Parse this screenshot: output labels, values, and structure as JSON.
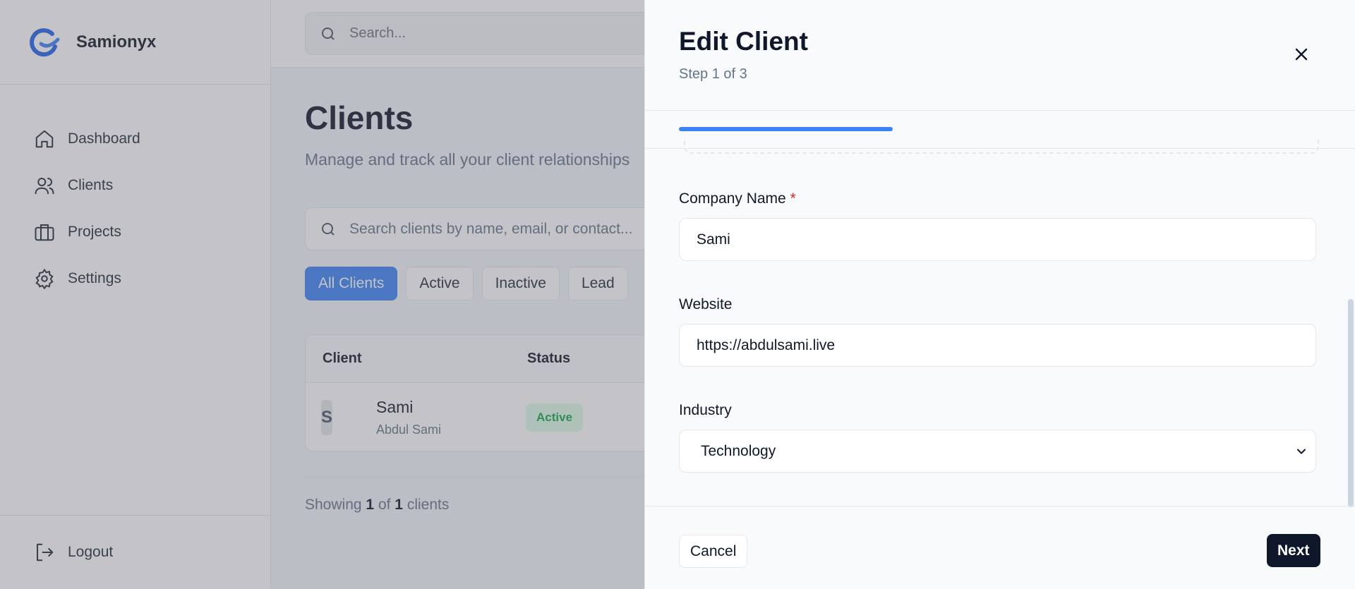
{
  "brand": {
    "name": "Samionyx",
    "logo_icon": "samionyx-logo-icon",
    "logo_color": "#2563eb"
  },
  "sidebar": {
    "items": [
      {
        "label": "Dashboard",
        "icon": "home-icon"
      },
      {
        "label": "Clients",
        "icon": "users-icon"
      },
      {
        "label": "Projects",
        "icon": "briefcase-icon"
      },
      {
        "label": "Settings",
        "icon": "gear-icon"
      }
    ],
    "logout": {
      "label": "Logout",
      "icon": "logout-icon"
    }
  },
  "topbar": {
    "search_placeholder": "Search..."
  },
  "main": {
    "title": "Clients",
    "subtitle": "Manage and track all your client relationships",
    "search_placeholder": "Search clients by name, email, or contact...",
    "filters": [
      "All Clients",
      "Active",
      "Inactive",
      "Lead"
    ],
    "active_filter": "All Clients",
    "table": {
      "headers": [
        "Client",
        "Status"
      ],
      "rows": [
        {
          "initial": "S",
          "name": "Sami",
          "contact": "Abdul Sami",
          "status": "Active"
        }
      ]
    },
    "showing": {
      "prefix": "Showing",
      "count": "1",
      "of": "of",
      "total": "1",
      "suffix": "clients"
    }
  },
  "drawer": {
    "title": "Edit Client",
    "step": "Step 1 of 3",
    "progress": 0.333,
    "fields": {
      "company": {
        "label": "Company Name",
        "required": "*",
        "value": "Sami"
      },
      "website": {
        "label": "Website",
        "value": "https://abdulsami.live"
      },
      "industry": {
        "label": "Industry",
        "value": "Technology"
      }
    },
    "cancel_label": "Cancel",
    "next_label": "Next"
  },
  "colors": {
    "accent": "#3b82f6",
    "primary_dark": "#0f172a",
    "status_active": "#16a34a"
  }
}
